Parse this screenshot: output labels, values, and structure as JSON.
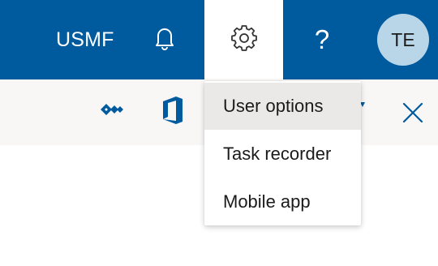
{
  "header": {
    "company": "USMF",
    "help_label": "?",
    "avatar_initials": "TE",
    "bar_color": "#005a9e"
  },
  "icons": {
    "notifications": "bell-icon",
    "settings": "gear-icon",
    "help": "question-mark-icon",
    "dynamics": "dynamics-logo-icon",
    "office": "office-logo-icon",
    "expand": "caret-down-icon",
    "close": "close-icon"
  },
  "settings_menu": {
    "items": [
      {
        "label": "User options",
        "highlighted": true
      },
      {
        "label": "Task recorder",
        "highlighted": false
      },
      {
        "label": "Mobile app",
        "highlighted": false
      }
    ]
  }
}
